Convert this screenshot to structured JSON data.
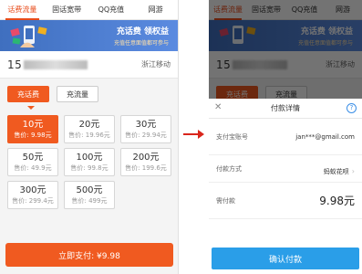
{
  "nav": [
    "话费流量",
    "固话宽带",
    "QQ充值",
    "网游"
  ],
  "banner": {
    "title": "充话费 领权益",
    "subtitle": "充值任意面值都可参与"
  },
  "phone": {
    "number_prefix": "15",
    "number_masked": "0866 1274",
    "carrier": "浙江移动"
  },
  "tabs": {
    "recharge": "充话费",
    "traffic": "充流量"
  },
  "options": [
    {
      "amount": "10元",
      "price": "售价: 9.98元",
      "selected": true
    },
    {
      "amount": "20元",
      "price": "售价: 19.96元",
      "selected": false
    },
    {
      "amount": "30元",
      "price": "售价: 29.94元",
      "selected": false
    },
    {
      "amount": "50元",
      "price": "售价: 49.9元",
      "selected": false
    },
    {
      "amount": "100元",
      "price": "售价: 99.8元",
      "selected": false
    },
    {
      "amount": "200元",
      "price": "售价: 199.6元",
      "selected": false
    },
    {
      "amount": "300元",
      "price": "售价: 299.4元",
      "selected": false
    },
    {
      "amount": "500元",
      "price": "售价: 499元",
      "selected": false
    }
  ],
  "pay_button": "立即支付: ¥9.98",
  "sheet": {
    "title": "付款详情",
    "close": "✕",
    "help": "?",
    "account_label": "支付宝账号",
    "account_value": "jan***@gmail.com",
    "method_label": "付款方式",
    "method_value": "蚂蚁花呗",
    "amount_label": "需付款",
    "amount_value": "9.98元",
    "confirm": "确认付款"
  },
  "colors": {
    "accent": "#f05a20",
    "confirm": "#2a9ee8"
  }
}
